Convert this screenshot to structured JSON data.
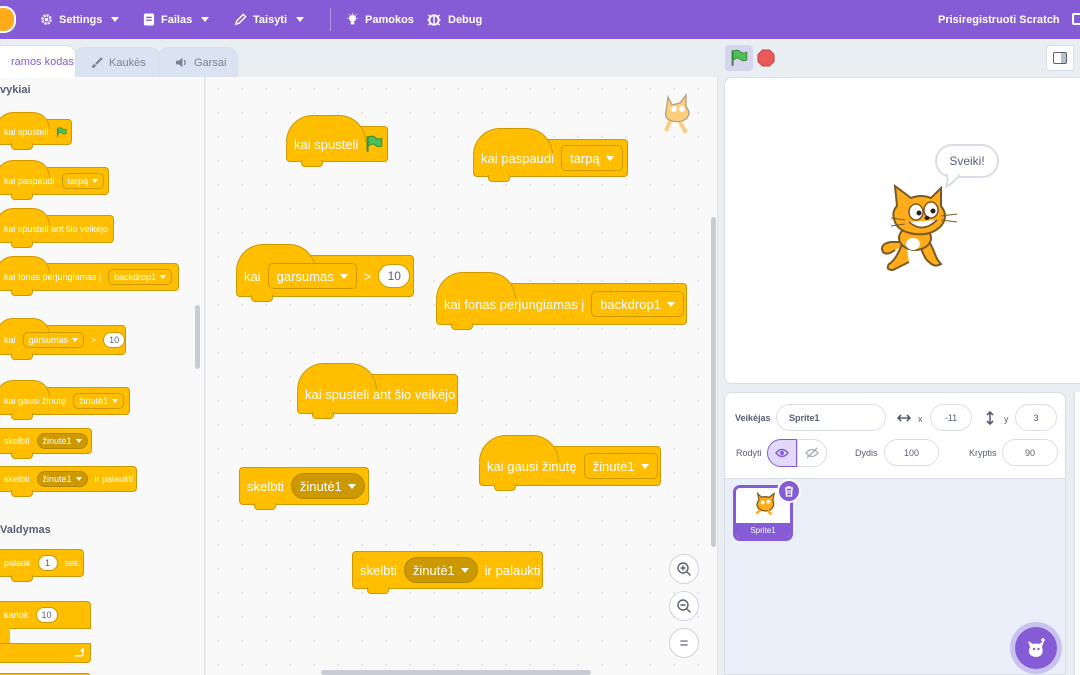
{
  "menubar": {
    "settings": "Settings",
    "file": "Failas",
    "edit": "Taisyti",
    "tutorials": "Pamokos",
    "debug": "Debug",
    "join": "Prisiregistruoti Scratch"
  },
  "tabs": {
    "code": "ramos kodas",
    "costumes": "Kaukės",
    "sounds": "Garsai"
  },
  "palette": {
    "events_title": "vykiai",
    "control_title": "Valdymas",
    "when_flag": "kai spusteli",
    "when_key": "kai paspaudi",
    "when_key_value": "tarpą",
    "when_sprite_clicked": "kai spusteli ant šio veikėjo",
    "when_backdrop": "kai fonas perjungiamas į",
    "when_backdrop_value": "backdrop1",
    "when_loudness": "kai",
    "when_loudness_value": "garsumas",
    "gt": ">",
    "loudness_num": "10",
    "when_receive": "kai gausi žinutę",
    "when_receive_value": "žinutė1",
    "broadcast": "skelbti",
    "broadcast_value": "žinutė1",
    "broadcast_wait": "skelbti",
    "broadcast_wait_value": "žinutė1",
    "broadcast_wait_suffix": "ir palaukti",
    "wait": "palauk",
    "wait_num": "1",
    "wait_unit": "sek.",
    "repeat": "kartok",
    "repeat_num": "10"
  },
  "script": {
    "when_flag": "kai spusteli",
    "when_key": "kai paspaudi",
    "when_key_value": "tarpą",
    "when_loudness": "kai",
    "when_loudness_value": "garsumas",
    "gt": ">",
    "loudness_num": "10",
    "when_backdrop": "kai fonas perjungiamas į",
    "when_backdrop_value": "backdrop1",
    "when_sprite_clicked": "kai spusteli ant šio veikėjo",
    "when_receive": "kai gausi žinutę",
    "when_receive_value": "žinutė1",
    "broadcast": "skelbti",
    "broadcast_value": "žinutė1",
    "broadcast_wait": "skelbti",
    "broadcast_wait_value": "žinutė1",
    "broadcast_wait_suffix": "ir palaukti",
    "zoom_reset": "="
  },
  "stage": {
    "speech": "Sveiki!"
  },
  "sprite_info": {
    "sprite_label": "Veikėjas",
    "sprite_name": "Sprite1",
    "x_label": "x",
    "x_value": "-11",
    "y_label": "y",
    "y_value": "3",
    "show_label": "Rodyti",
    "size_label": "Dydis",
    "size_value": "100",
    "direction_label": "Kryptis",
    "direction_value": "90"
  },
  "sprite_list": {
    "sprites": [
      "Sprite1"
    ]
  },
  "colors": {
    "menu": "#855cd6",
    "events": "#ffbf00",
    "events_border": "#cc9900",
    "flag": "#4cbf56",
    "stop": "#ec5959"
  }
}
